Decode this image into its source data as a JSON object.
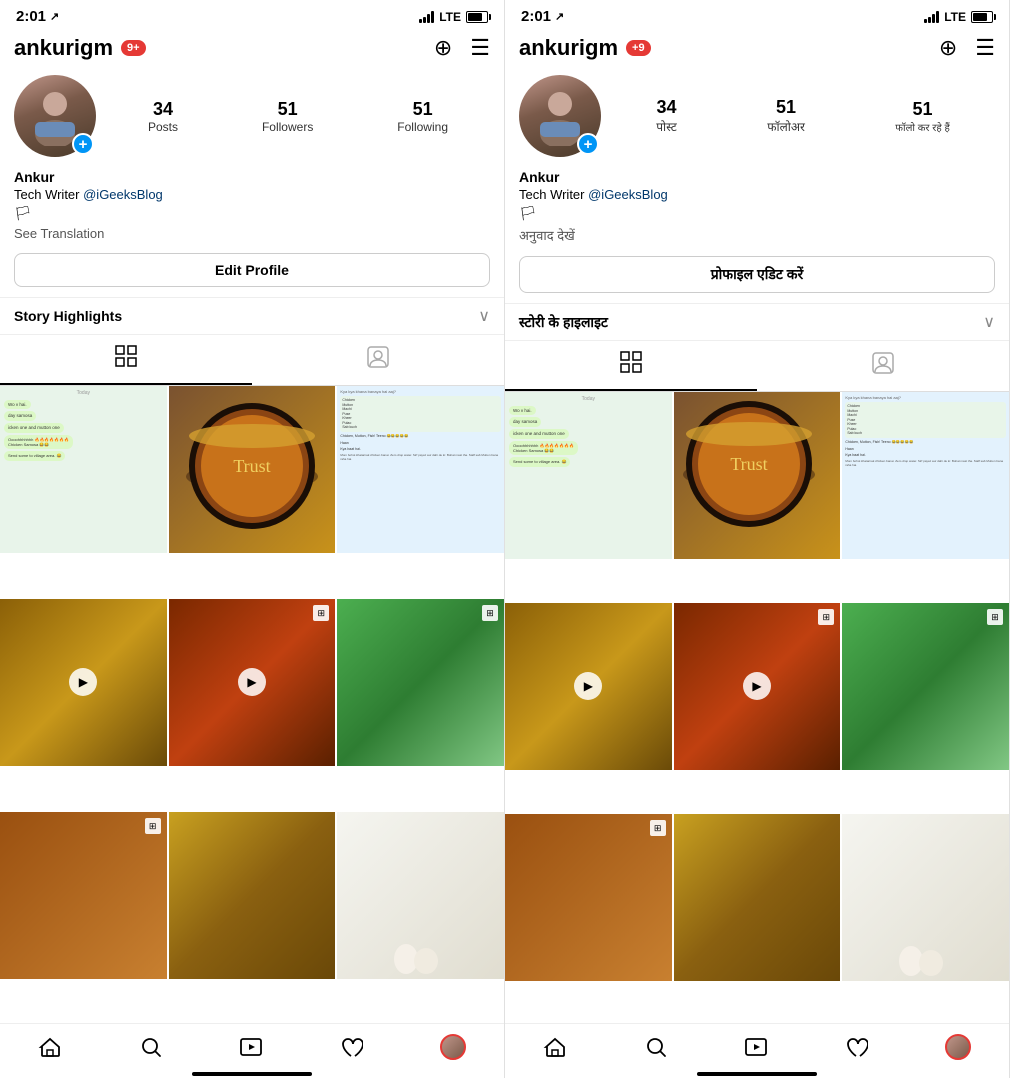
{
  "phone1": {
    "statusBar": {
      "time": "2:01",
      "arrow": "↗",
      "lte": "LTE"
    },
    "header": {
      "username": "ankurigm",
      "badge": "9+",
      "addIcon": "⊞",
      "menuIcon": "≡"
    },
    "profile": {
      "posts": "34",
      "postsLabel": "Posts",
      "followers": "51",
      "followersLabel": "Followers",
      "following": "51",
      "followingLabel": "Following"
    },
    "bio": {
      "name": "Ankur",
      "line1": "Tech Writer @iGeeksBlog",
      "flag": "🏳",
      "seeTranslation": "See Translation"
    },
    "editProfile": "Edit Profile",
    "storyHighlights": "Story Highlights",
    "tabs": {
      "grid": "⊞",
      "person": "👤"
    },
    "bottomNav": {
      "home": "🏠",
      "search": "🔍",
      "reels": "▶",
      "heart": "♡"
    }
  },
  "phone2": {
    "statusBar": {
      "time": "2:01",
      "arrow": "↗",
      "lte": "LTE"
    },
    "header": {
      "username": "ankurigm",
      "badge": "+9",
      "addIcon": "⊞",
      "menuIcon": "≡"
    },
    "profile": {
      "posts": "34",
      "postsLabel": "पोस्ट",
      "followers": "51",
      "followersLabel": "फॉलोअर",
      "following": "51",
      "followingLabel": "फॉलो कर रहे हैं"
    },
    "bio": {
      "name": "Ankur",
      "line1": "Tech Writer @iGeeksBlog",
      "flag": "🏳",
      "seeTranslation": "अनुवाद देखें"
    },
    "editProfile": "प्रोफाइल एडिट करें",
    "storyHighlights": "स्टोरी के हाइलाइट",
    "tabs": {
      "grid": "⊞",
      "person": "👤"
    },
    "bottomNav": {
      "home": "🏠",
      "search": "🔍",
      "reels": "▶",
      "heart": "♡"
    }
  }
}
